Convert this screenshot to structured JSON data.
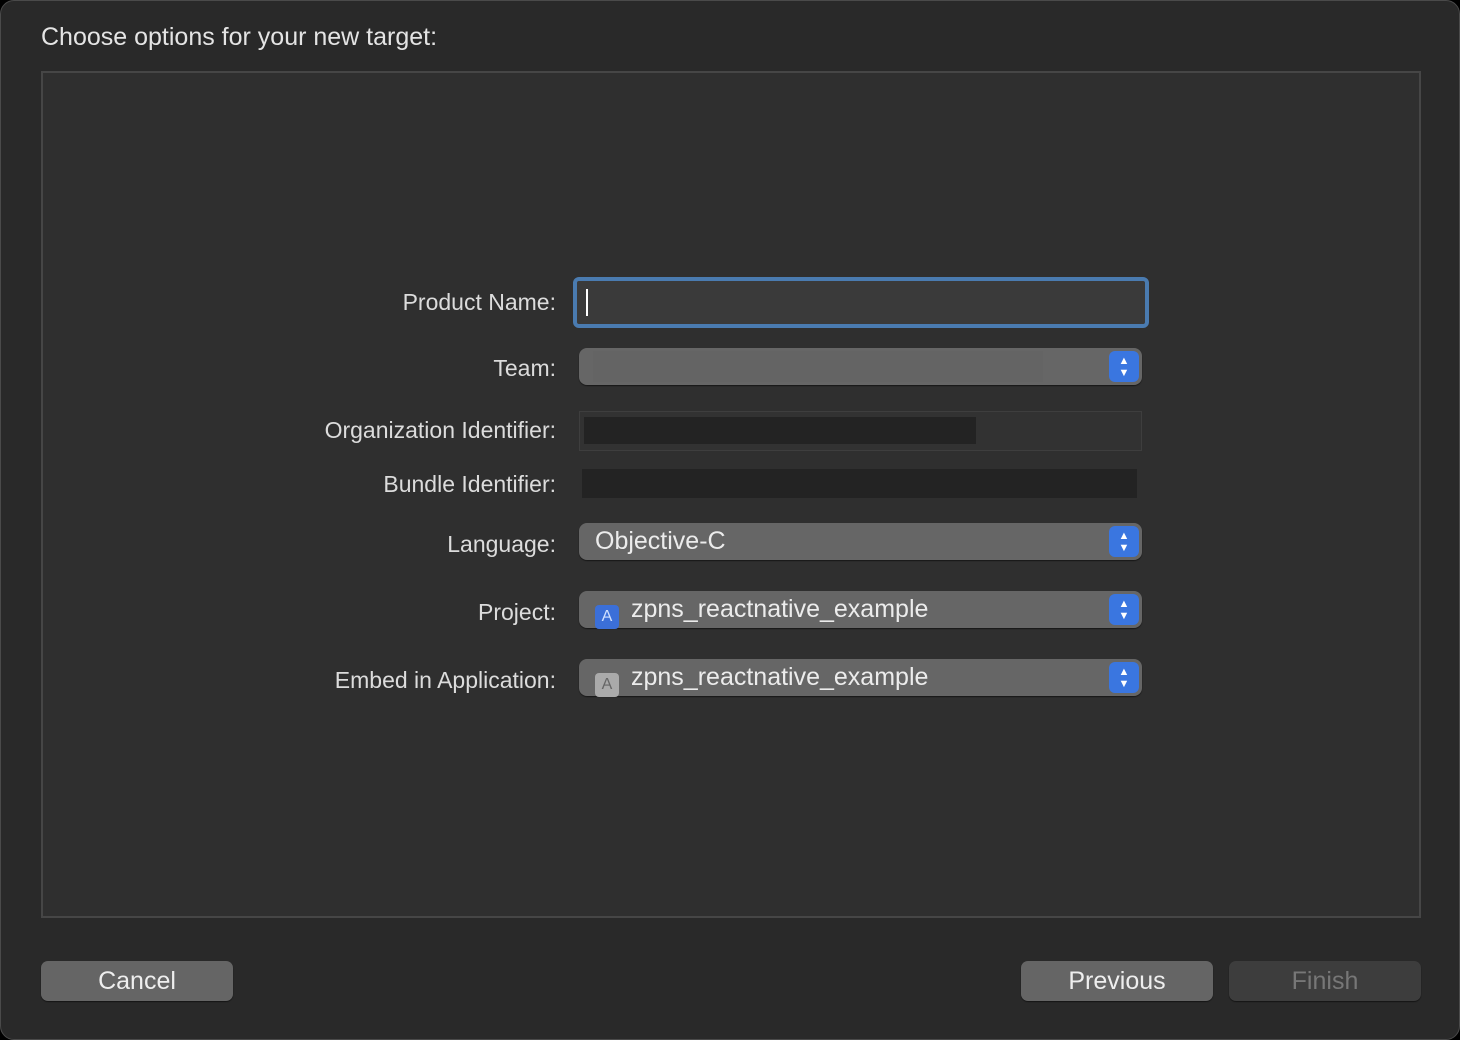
{
  "title": "Choose options for your new target:",
  "form": {
    "product_name": {
      "label": "Product Name:",
      "value": ""
    },
    "team": {
      "label": "Team:"
    },
    "org_id": {
      "label": "Organization Identifier:"
    },
    "bundle_id": {
      "label": "Bundle Identifier:"
    },
    "language": {
      "label": "Language:",
      "value": "Objective-C"
    },
    "project": {
      "label": "Project:",
      "value": "zpns_reactnative_example",
      "icon": "app-store-icon"
    },
    "embed": {
      "label": "Embed in Application:",
      "value": "zpns_reactnative_example",
      "icon": "app-store-icon"
    }
  },
  "buttons": {
    "cancel": "Cancel",
    "previous": "Previous",
    "finish": "Finish"
  },
  "colors": {
    "accent": "#3a76e0",
    "focus_ring": "#4a7bb0"
  }
}
